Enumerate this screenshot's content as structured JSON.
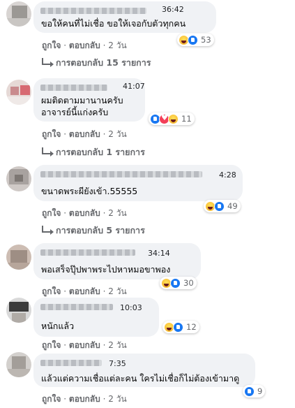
{
  "actions": {
    "like": "ถูกใจ",
    "reply": "ตอบกลับ",
    "sep": "·"
  },
  "comments": [
    {
      "stamp": "36:42",
      "text": "ขอให้คนที่ไม่เชื่อ ขอให้เจอกับตัวทุกคน",
      "count": "53",
      "age": "2 วัน",
      "replies": "การตอบกลับ 15 รายการ"
    },
    {
      "stamp": "41:07",
      "text": "ผมติดตามมานานครับ",
      "text2": "อาจารย์นี้แก่งครับ",
      "count": "11",
      "age": "2 วัน",
      "replies": "การตอบกลับ 1 รายการ"
    },
    {
      "stamp": "4:28",
      "text": "ขนาดพระผียังเข้า.55555",
      "count": "49",
      "age": "2 วัน",
      "replies": "การตอบกลับ 5 รายการ"
    },
    {
      "stamp": "34:14",
      "text": "พอเสร็จปุ๊ปพาพระไปหาหมอขาพอง",
      "count": "30",
      "age": "2 วัน"
    },
    {
      "stamp": "10:03",
      "text": "หนักแล้ว",
      "count": "12",
      "age": "2 วัน"
    },
    {
      "stamp": "7:35",
      "text": "แล้วแต่ความเชื่อแต่ละคน ใครไม่เชื่อก็ไม่ต้องเข้ามาดู",
      "count": "9",
      "age": "2 วัน"
    }
  ]
}
